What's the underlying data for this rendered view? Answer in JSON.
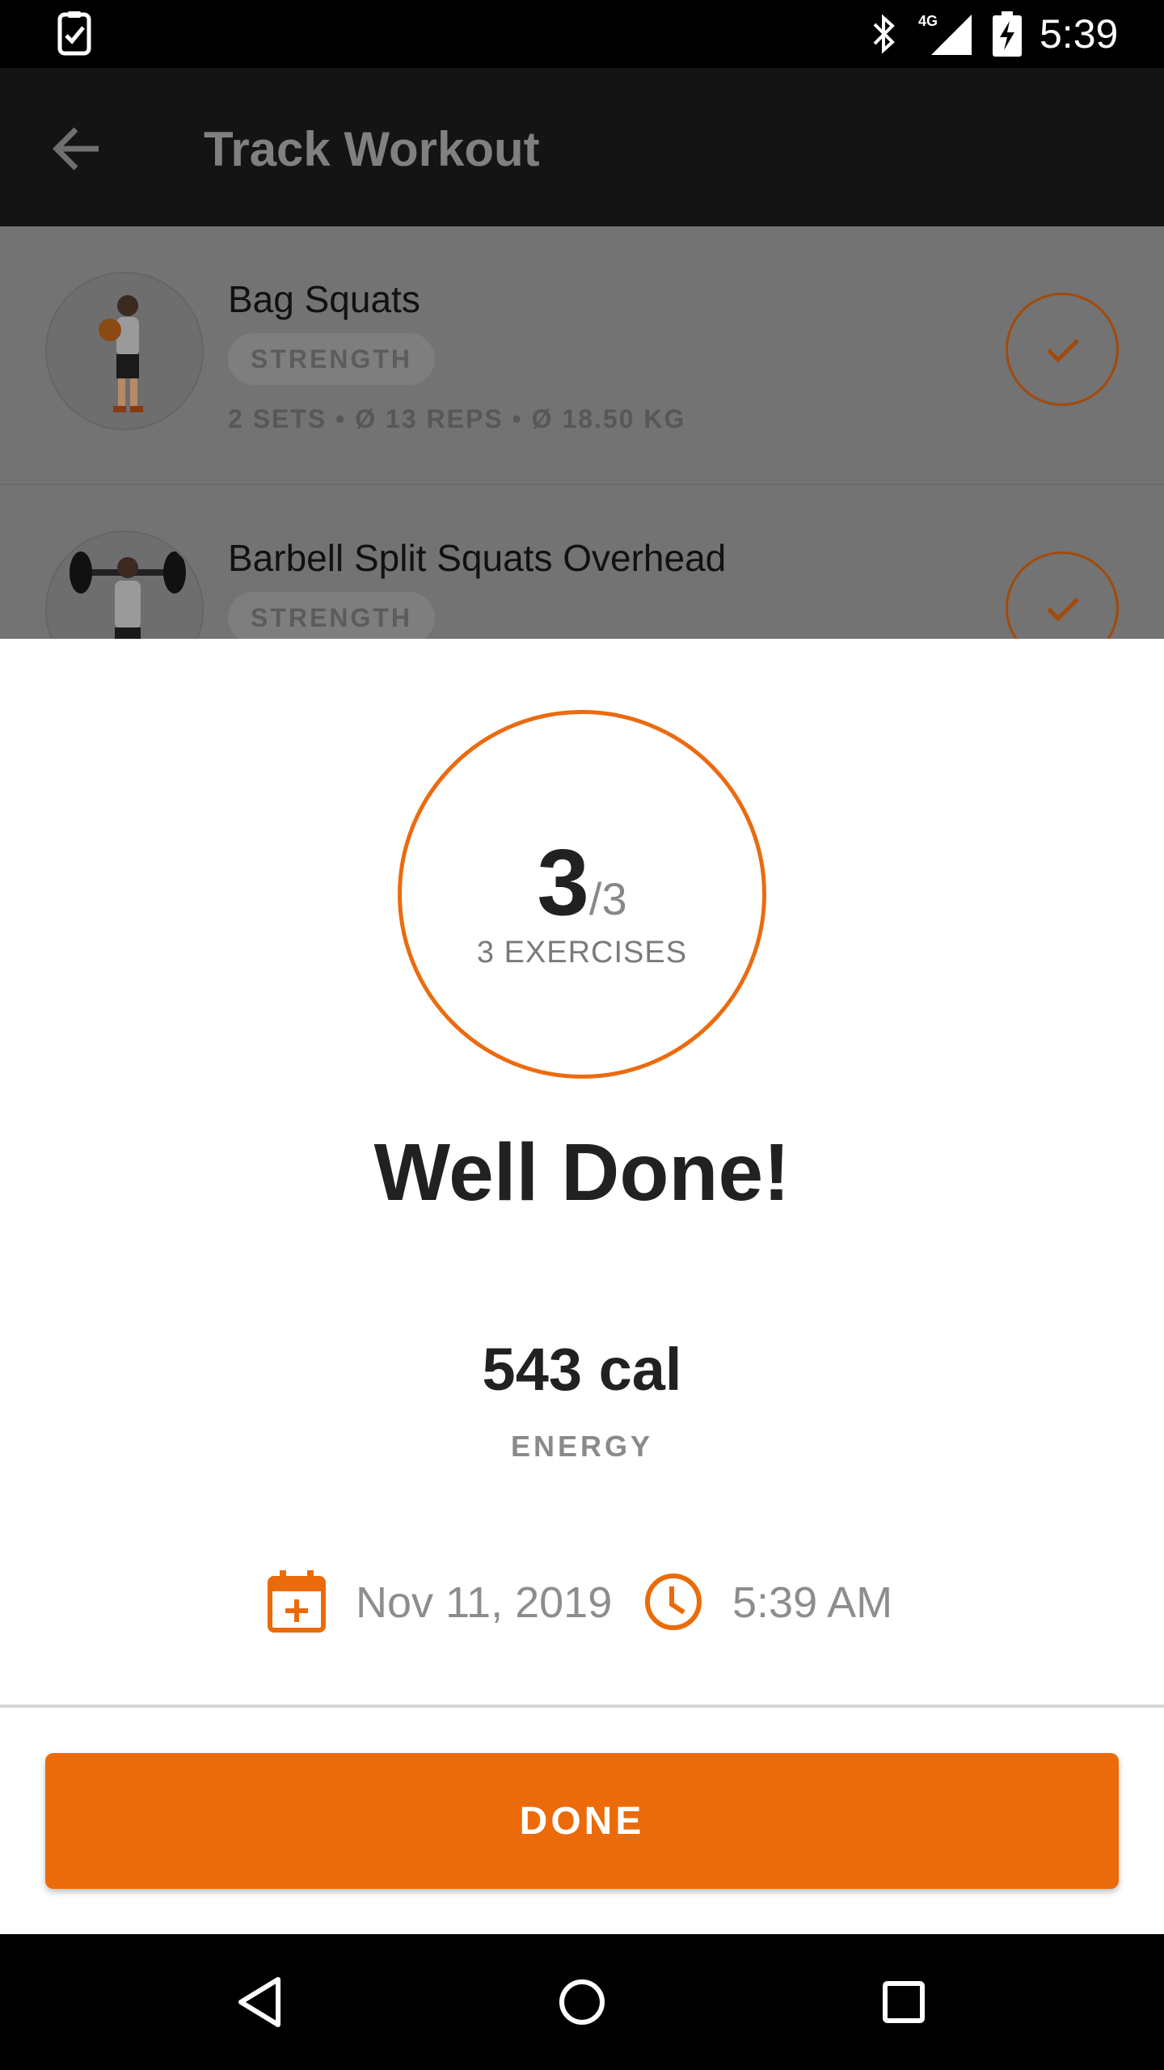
{
  "status_bar": {
    "time": "5:39",
    "network": "4G",
    "icons": [
      "task-check-icon",
      "bluetooth-icon",
      "signal-icon",
      "battery-charging-icon"
    ]
  },
  "app_bar": {
    "title": "Track Workout",
    "back_icon": "arrow-back-icon"
  },
  "exercises": [
    {
      "name": "Bag Squats",
      "category": "STRENGTH",
      "meta": "2 SETS • Ø 13 REPS  • Ø 18.50 KG",
      "completed": true
    },
    {
      "name": "Barbell Split Squats Overhead",
      "category": "STRENGTH",
      "completed": true
    }
  ],
  "summary": {
    "completed": "3",
    "total": "/3",
    "exercises_label": "3 EXERCISES",
    "headline": "Well Done!",
    "energy_value": "543 cal",
    "energy_label": "ENERGY",
    "date": "Nov 11, 2019",
    "time": "5:39 AM"
  },
  "done_button": {
    "label": "DONE"
  },
  "colors": {
    "accent": "#eb6b0a",
    "dim_overlay": "#737373",
    "app_bar": "#141414"
  }
}
